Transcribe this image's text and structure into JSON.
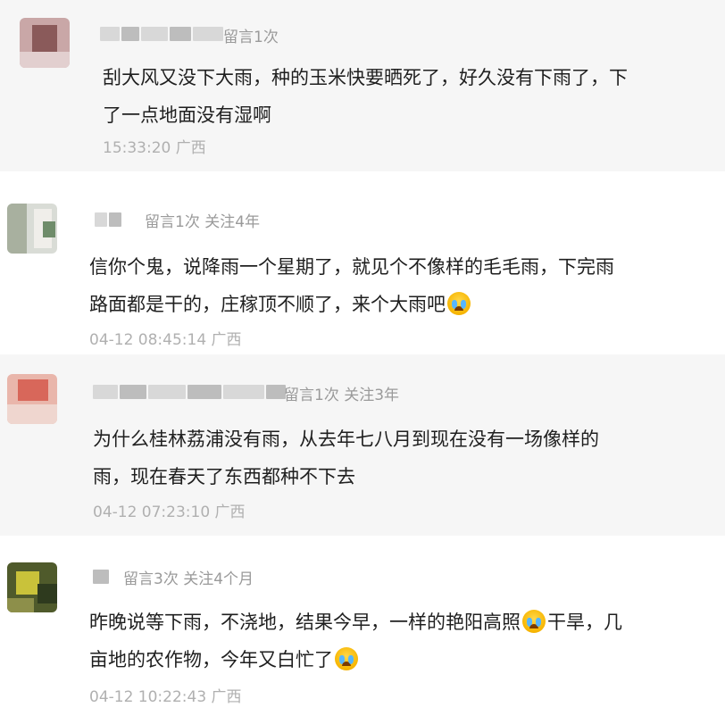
{
  "comments": [
    {
      "meta": "留言1次",
      "text_lines": [
        "刮大风又没下大雨，种的玉米快要晒死了，好久没有下雨了，下",
        "了一点地面没有湿啊"
      ],
      "time": "15:33:20 广西"
    },
    {
      "meta": "留言1次 关注4年",
      "text_lines": [
        "信你个鬼，说降雨一个星期了，就见个不像样的毛毛雨，下完雨",
        "路面都是干的，庄稼顶不顺了，来个大雨吧"
      ],
      "emoji": "crying-emoji",
      "time": "04-12 08:45:14 广西"
    },
    {
      "meta": "留言1次 关注3年",
      "text_lines": [
        "为什么桂林荔浦没有雨，从去年七八月到现在没有一场像样的",
        "雨，现在春天了东西都种不下去"
      ],
      "time": "04-12 07:23:10 广西"
    },
    {
      "meta": "留言3次 关注4个月",
      "text_lines_parts": {
        "line1_a": "昨晚说等下雨，不浇地，结果今早，一样的艳阳高照",
        "line1_b": "干旱，几",
        "line2": "亩地的农作物，今年又白忙了"
      },
      "emoji": "crying-emoji",
      "time": "04-12 10:22:43 广西"
    }
  ]
}
